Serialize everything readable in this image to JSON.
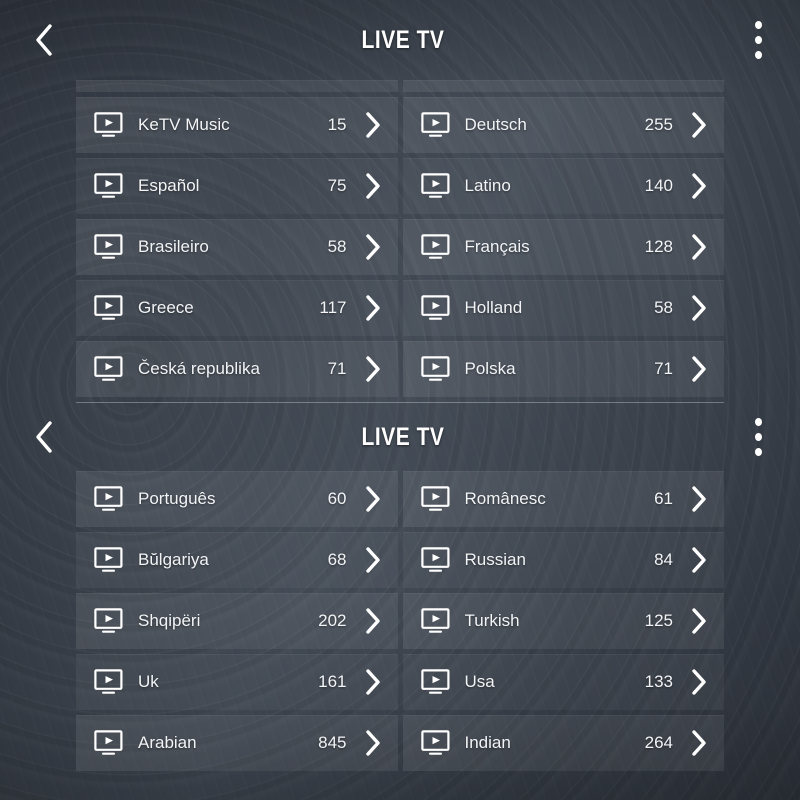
{
  "app": {
    "background_color": "#363c45",
    "row_color": "#4e5660",
    "text_color": "#f2f4f6"
  },
  "sections": [
    {
      "header": {
        "title": "LIVE TV",
        "back_icon": "chevron-left-icon",
        "menu_icon": "overflow-menu-icon"
      },
      "rows": [
        [
          {
            "icon": "tv-play-icon",
            "label": "KeTV Music",
            "count": "15",
            "chevron": "chevron-right-icon"
          },
          {
            "icon": "tv-play-icon",
            "label": "Deutsch",
            "count": "255",
            "chevron": "chevron-right-icon"
          }
        ],
        [
          {
            "icon": "tv-play-icon",
            "label": "Español",
            "count": "75",
            "chevron": "chevron-right-icon"
          },
          {
            "icon": "tv-play-icon",
            "label": "Latino",
            "count": "140",
            "chevron": "chevron-right-icon"
          }
        ],
        [
          {
            "icon": "tv-play-icon",
            "label": "Brasileiro",
            "count": "58",
            "chevron": "chevron-right-icon"
          },
          {
            "icon": "tv-play-icon",
            "label": "Français",
            "count": "128",
            "chevron": "chevron-right-icon"
          }
        ],
        [
          {
            "icon": "tv-play-icon",
            "label": "Greece",
            "count": "117",
            "chevron": "chevron-right-icon"
          },
          {
            "icon": "tv-play-icon",
            "label": "Holland",
            "count": "58",
            "chevron": "chevron-right-icon"
          }
        ],
        [
          {
            "icon": "tv-play-icon",
            "label": "Česká republika",
            "count": "71",
            "chevron": "chevron-right-icon"
          },
          {
            "icon": "tv-play-icon",
            "label": "Polska",
            "count": "71",
            "chevron": "chevron-right-icon"
          }
        ]
      ]
    },
    {
      "header": {
        "title": "LIVE TV",
        "back_icon": "chevron-left-icon",
        "menu_icon": "overflow-menu-icon"
      },
      "rows": [
        [
          {
            "icon": "tv-play-icon",
            "label": "Português",
            "count": "60",
            "chevron": "chevron-right-icon"
          },
          {
            "icon": "tv-play-icon",
            "label": "Românesc",
            "count": "61",
            "chevron": "chevron-right-icon"
          }
        ],
        [
          {
            "icon": "tv-play-icon",
            "label": "Bŭlgariya",
            "count": "68",
            "chevron": "chevron-right-icon"
          },
          {
            "icon": "tv-play-icon",
            "label": "Russian",
            "count": "84",
            "chevron": "chevron-right-icon"
          }
        ],
        [
          {
            "icon": "tv-play-icon",
            "label": "Shqipëri",
            "count": "202",
            "chevron": "chevron-right-icon"
          },
          {
            "icon": "tv-play-icon",
            "label": "Turkish",
            "count": "125",
            "chevron": "chevron-right-icon"
          }
        ],
        [
          {
            "icon": "tv-play-icon",
            "label": "Uk",
            "count": "161",
            "chevron": "chevron-right-icon"
          },
          {
            "icon": "tv-play-icon",
            "label": "Usa",
            "count": "133",
            "chevron": "chevron-right-icon"
          }
        ],
        [
          {
            "icon": "tv-play-icon",
            "label": "Arabian",
            "count": "845",
            "chevron": "chevron-right-icon"
          },
          {
            "icon": "tv-play-icon",
            "label": "Indian",
            "count": "264",
            "chevron": "chevron-right-icon"
          }
        ]
      ]
    }
  ]
}
